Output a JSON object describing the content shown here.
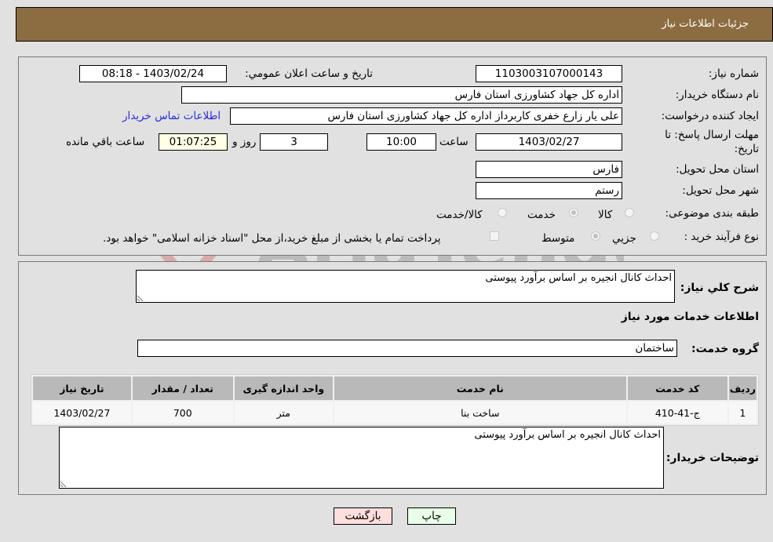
{
  "header": {
    "title": "جزئیات اطلاعات نیاز"
  },
  "form": {
    "need_number": {
      "label": "شماره نیاز:",
      "value": "1103003107000143"
    },
    "announce": {
      "label": "تاریخ و ساعت اعلان عمومي:",
      "value": "1403/02/24 - 08:18"
    },
    "buyer_org": {
      "label": "نام دستگاه خریدار:",
      "value": "اداره کل جهاد کشاورزی استان فارس"
    },
    "requester": {
      "label": "ایجاد کننده درخواست:",
      "value": "علی یار زارع خفری کاربرداز اداره کل جهاد کشاورزی استان فارس"
    },
    "contact_link": "اطلاعات تماس خریدار",
    "deadline": {
      "label_line1": "مهلت ارسال پاسخ: تا",
      "label_line2": "تاریخ:",
      "date": "1403/02/27",
      "time_label": "ساعت",
      "time": "10:00",
      "days": "3",
      "days_label": "روز و",
      "remaining": "01:07:25",
      "remaining_label": "ساعت باقي مانده"
    },
    "province": {
      "label": "استان محل تحویل:",
      "value": "فارس"
    },
    "city": {
      "label": "شهر محل تحویل:",
      "value": "رستم"
    },
    "category": {
      "label": "طبقه بندی موضوعی:",
      "options": [
        "کالا",
        "خدمت",
        "کالا/خدمت"
      ],
      "selected": "خدمت"
    },
    "process": {
      "label": "نوع فرآیند خرید :",
      "options": [
        "جزيي",
        "متوسط"
      ],
      "selected": "متوسط",
      "treasury_note": "پرداخت تمام یا بخشی از مبلغ خرید،از محل \"اسناد خزانه اسلامی\" خواهد بود."
    }
  },
  "details": {
    "summary_label": "شرح کلي نیاز:",
    "summary_value": "احداث کانال انجیره بر اساس برآورد پیوستی",
    "services_heading": "اطلاعات خدمات مورد نیاز",
    "service_group_label": "گروه خدمت:",
    "service_group_value": "ساختمان",
    "table": {
      "headers": [
        "ردیف",
        "کد خدمت",
        "نام خدمت",
        "واحد اندازه گیری",
        "تعداد / مقدار",
        "تاریخ نیاز"
      ],
      "rows": [
        [
          "1",
          "ج-41-410",
          "ساخت بنا",
          "متر",
          "700",
          "1403/02/27"
        ]
      ]
    },
    "buyer_notes_label": "توضیحات خریدار:",
    "buyer_notes_value": "احداث کانال انجیره بر اساس برآورد پیوستی"
  },
  "buttons": {
    "print": "چاپ",
    "back": "بازگشت"
  },
  "watermark": "AriaTender.neT",
  "colors": {
    "header_bg": "#8c6d41",
    "print_bg": "#eaffea",
    "back_bg": "#ffdede",
    "link": "#2a2ae0"
  }
}
